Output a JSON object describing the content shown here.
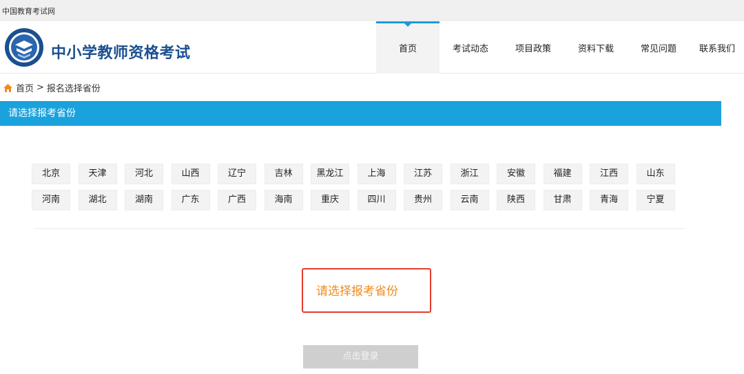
{
  "topbar": {
    "site_name": "中国教育考试网"
  },
  "header": {
    "title": "中小学教师资格考试",
    "nav": [
      {
        "label": "首页",
        "active": true
      },
      {
        "label": "考试动态",
        "active": false
      },
      {
        "label": "项目政策",
        "active": false
      },
      {
        "label": "资料下载",
        "active": false
      },
      {
        "label": "常见问题",
        "active": false
      },
      {
        "label": "联系我们",
        "active": false
      }
    ],
    "accent_color": "#1a9bd7"
  },
  "breadcrumb": {
    "home": "首页",
    "separator": ">",
    "current": "报名选择省份"
  },
  "panel": {
    "title": "请选择报考省份",
    "color": "#1aa2dc"
  },
  "provinces": {
    "row1": [
      "北京",
      "天津",
      "河北",
      "山西",
      "辽宁",
      "吉林",
      "黑龙江",
      "上海",
      "江苏",
      "浙江",
      "安徽",
      "福建",
      "江西",
      "山东"
    ],
    "row2": [
      "河南",
      "湖北",
      "湖南",
      "广东",
      "广西",
      "海南",
      "重庆",
      "四川",
      "贵州",
      "云南",
      "陕西",
      "甘肃",
      "青海",
      "宁夏"
    ]
  },
  "prompt": {
    "text": "请选择报考省份",
    "text_color": "#f08a1c",
    "border_color": "#e53a2d"
  },
  "login_button": {
    "label": "点击登录"
  },
  "icons": {
    "home": "home-icon",
    "logo": "exam-logo-icon"
  }
}
